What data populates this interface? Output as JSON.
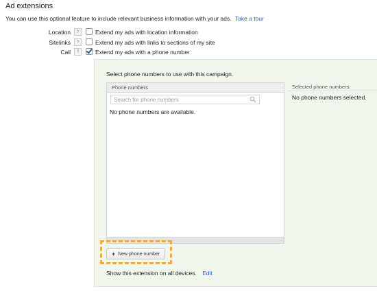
{
  "section": {
    "title": "Ad extensions",
    "intro_text": "You can use this optional feature to include relevant business information with your ads.",
    "tour_link": "Take a tour"
  },
  "extensions": [
    {
      "label": "Location",
      "help": "?",
      "text": "Extend my ads with location information",
      "checked": false
    },
    {
      "label": "Sitelinks",
      "help": "?",
      "text": "Extend my ads with links to sections of my site",
      "checked": false
    },
    {
      "label": "Call",
      "help": "?",
      "text": "Extend my ads with a phone number",
      "checked": true
    }
  ],
  "call_panel": {
    "title": "Select phone numbers to use with this campaign.",
    "phone_numbers_header": "Phone numbers",
    "search_placeholder": "Search for phone numbers",
    "empty_message": "No phone numbers are available.",
    "selected_header": "Selected phone numbers:",
    "selected_empty": "No phone numbers selected.",
    "new_button_icon": "+",
    "new_button_label": "New phone number",
    "devices_text": "Show this extension on all devices.",
    "edit_link": "Edit"
  },
  "colors": {
    "link": "#2a5db0",
    "panel_bg": "#f2f7ee",
    "highlight": "#f0a93c"
  }
}
